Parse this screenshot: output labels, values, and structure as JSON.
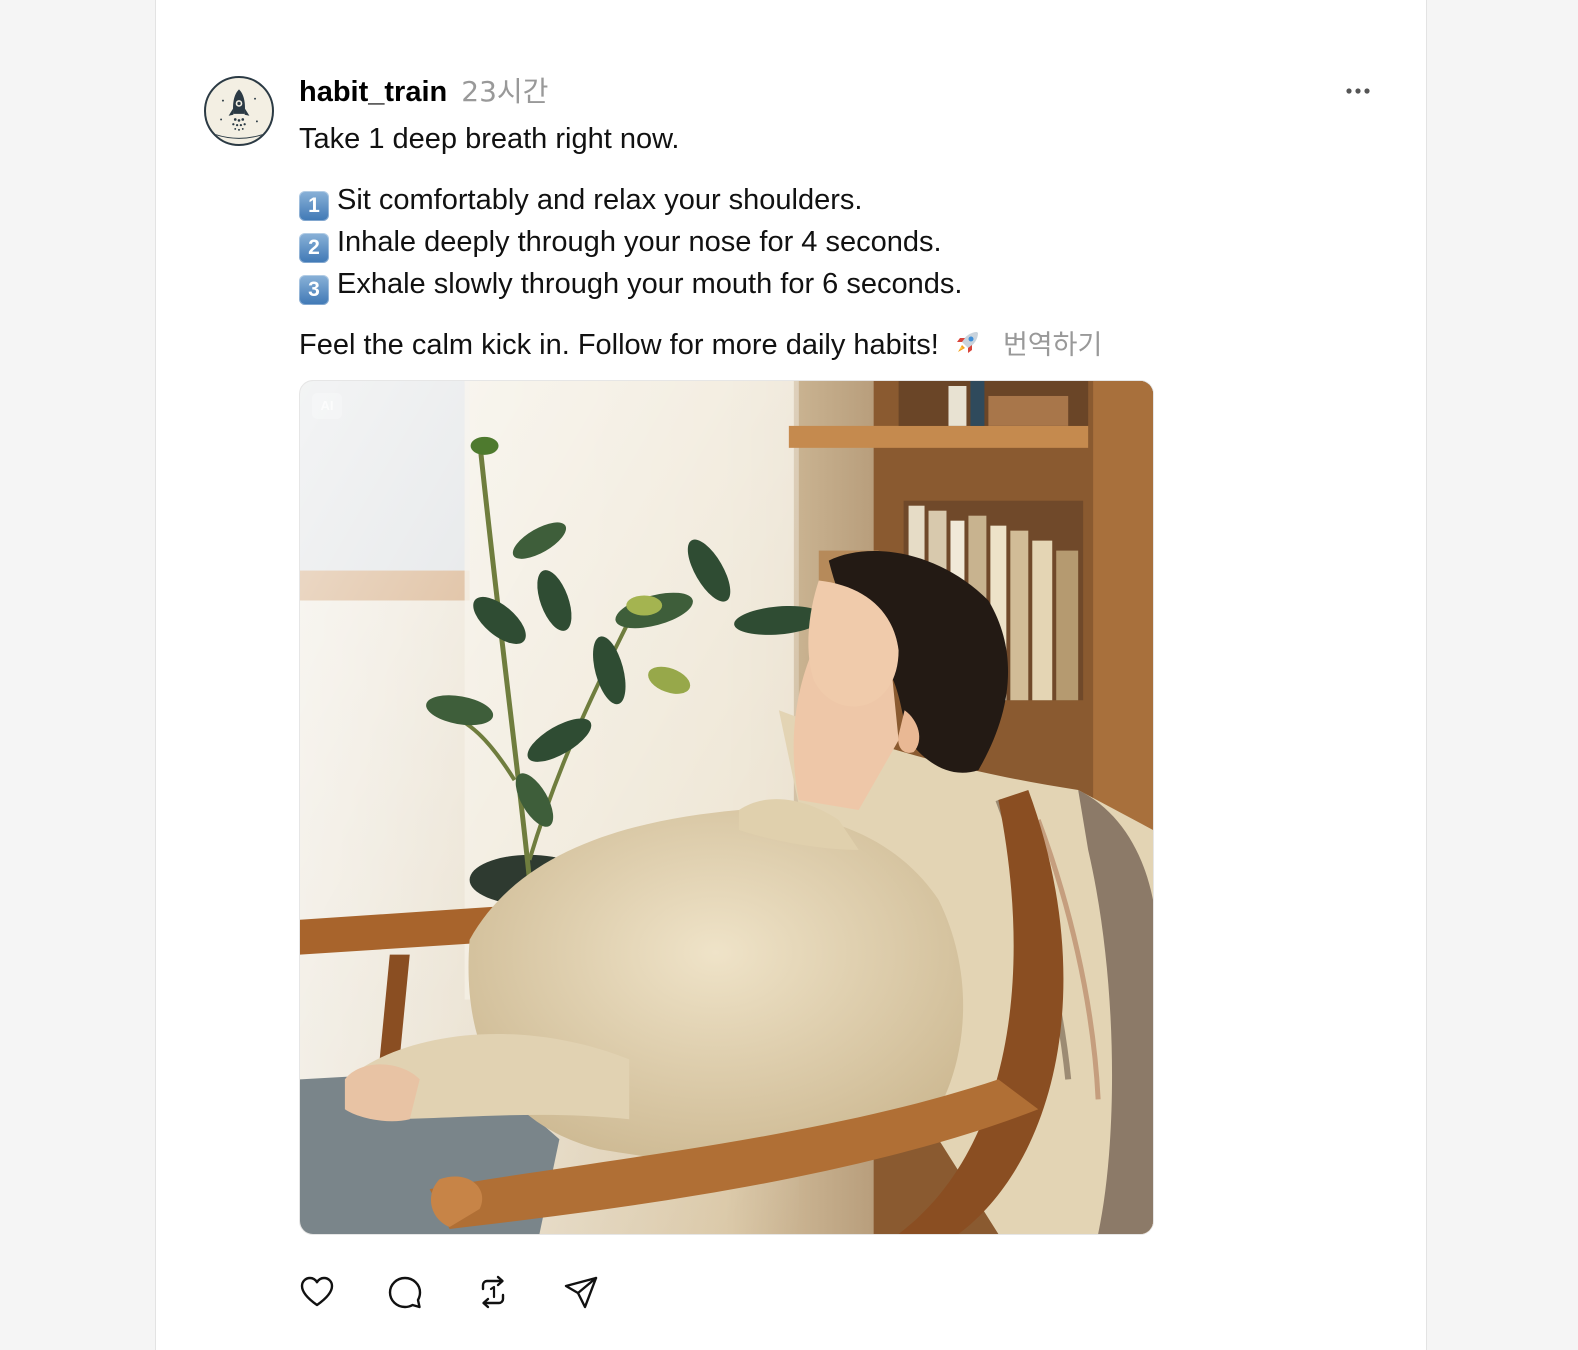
{
  "post": {
    "username": "habit_train",
    "timestamp": "23시간",
    "avatar_icon": "rocket-icon",
    "lines": {
      "intro": "Take 1 deep breath right now.",
      "step1_num": "1",
      "step1": "Sit comfortably and relax your shoulders.",
      "step2_num": "2",
      "step2": "Inhale deeply through your nose for 4 seconds.",
      "step3_num": "3",
      "step3": "Exhale slowly through your mouth for 6 seconds.",
      "outro": "Feel the calm kick in. Follow for more daily habits!"
    },
    "emoji": "rocket-emoji",
    "translate_label": "번역하기",
    "image": {
      "badge": "AI"
    }
  },
  "actions": {
    "like_icon": "heart-icon",
    "comment_icon": "comment-icon",
    "repost_icon": "repost-icon",
    "share_icon": "send-icon"
  },
  "colors": {
    "page_background": "#f5f5f5",
    "card_background": "#ffffff",
    "secondary_text": "#999999",
    "badge_blue": "#3f78b5"
  }
}
